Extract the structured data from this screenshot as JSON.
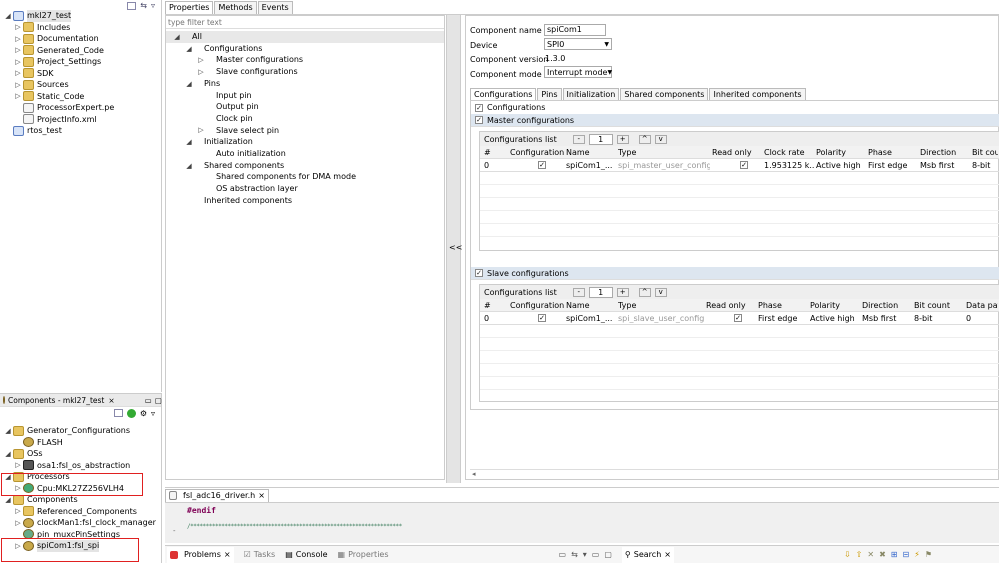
{
  "project_tree": {
    "root": "mkl27_test",
    "items": [
      "Includes",
      "Documentation",
      "Generated_Code",
      "Project_Settings",
      "SDK",
      "Sources",
      "Static_Code",
      "ProcessorExpert.pe",
      "ProjectInfo.xml"
    ],
    "second_root": "rtos_test"
  },
  "components_view": {
    "title": "Components - mkl27_test",
    "gen_cfg": "Generator_Configurations",
    "flash": "FLASH",
    "oss": "OSs",
    "osa": "osa1:fsl_os_abstraction",
    "processors": "Processors",
    "cpu": "Cpu:MKL27Z256VLH4",
    "components": "Components",
    "ref": "Referenced_Components",
    "clock": "clockMan1:fsl_clock_manager",
    "pinmux": "pin_muxcPinSettings",
    "spi": "spiCom1:fsl_spi"
  },
  "props_tabs": [
    "Properties",
    "Methods",
    "Events"
  ],
  "filter_placeholder": "type filter text",
  "nav_tree": {
    "all": "All",
    "configurations": "Configurations",
    "master": "Master configurations",
    "slave": "Slave configurations",
    "pins": "Pins",
    "input": "Input pin",
    "output": "Output pin",
    "clock": "Clock pin",
    "select": "Slave select pin",
    "init": "Initialization",
    "auto": "Auto initialization",
    "shared": "Shared components",
    "dma": "Shared components for DMA mode",
    "osab": "OS abstraction layer",
    "inherited": "Inherited components"
  },
  "collapse_label": "<<",
  "component": {
    "name_label": "Component name",
    "name_value": "spiCom1",
    "device_label": "Device",
    "device_value": "SPI0",
    "version_label": "Component version",
    "version_value": "1.3.0",
    "mode_label": "Component mode",
    "mode_value": "Interrupt mode"
  },
  "detail_tabs": [
    "Configurations",
    "Pins",
    "Initialization",
    "Shared components",
    "Inherited components"
  ],
  "configs_check": "Configurations",
  "master": {
    "title": "Master configurations",
    "list_label": "Configurations list",
    "list_value": "1",
    "minus": "-",
    "plus": "+",
    "up": "^",
    "down": "v",
    "headers": [
      "#",
      "Configuration",
      "Name",
      "Type",
      "Read only",
      "Clock rate",
      "Polarity",
      "Phase",
      "Direction",
      "Bit count"
    ],
    "row": [
      "0",
      "✓",
      "spiCom1_...",
      "spi_master_user_config_t",
      "✓",
      "1.953125 k...",
      "Active high",
      "First edge",
      "Msb first",
      "8-bit"
    ]
  },
  "slave": {
    "title": "Slave configurations",
    "list_label": "Configurations list",
    "list_value": "1",
    "minus": "-",
    "plus": "+",
    "up": "^",
    "down": "v",
    "headers": [
      "#",
      "Configuration",
      "Name",
      "Type",
      "Read only",
      "Phase",
      "Polarity",
      "Direction",
      "Bit count",
      "Data patte"
    ],
    "row": [
      "0",
      "✓",
      "spiCom1_...",
      "spi_slave_user_config_t",
      "✓",
      "First edge",
      "Active high",
      "Msb first",
      "8-bit",
      "0"
    ]
  },
  "editor": {
    "tab": "fsl_adc16_driver.h",
    "line1": "#endif",
    "line2": "/********************************************************************"
  },
  "bottom_tabs": {
    "problems": "Problems",
    "tasks": "Tasks",
    "console": "Console",
    "properties": "Properties",
    "search": "Search"
  }
}
